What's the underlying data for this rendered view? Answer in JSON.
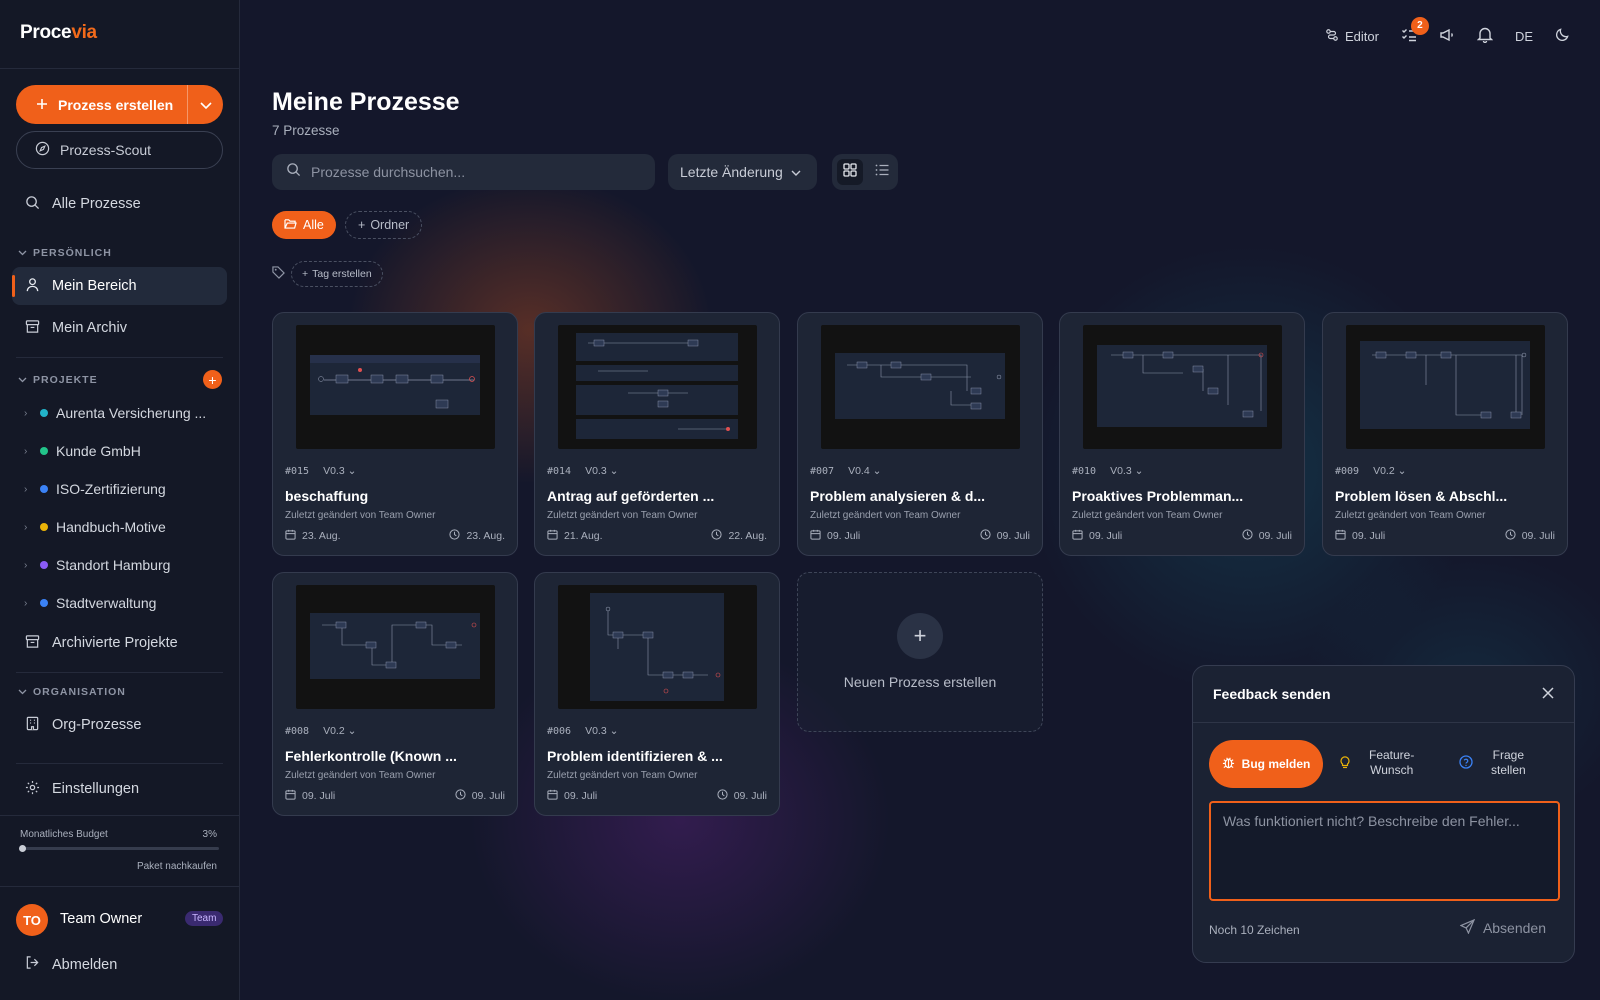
{
  "app": {
    "logo_main": "Proce",
    "logo_accent": "via"
  },
  "sidebar": {
    "create_label": "Prozess erstellen",
    "scout_label": "Prozess-Scout",
    "all_processes": "Alle Prozesse",
    "section_personal": "PERSÖNLICH",
    "my_area": "Mein Bereich",
    "my_archive": "Mein Archiv",
    "section_projects": "PROJEKTE",
    "projects": [
      {
        "name": "Aurenta Versicherung ...",
        "color": "#22b3c9"
      },
      {
        "name": "Kunde GmbH",
        "color": "#22c48a"
      },
      {
        "name": "ISO-Zertifizierung",
        "color": "#3b82f6"
      },
      {
        "name": "Handbuch-Motive",
        "color": "#eab308"
      },
      {
        "name": "Standort Hamburg",
        "color": "#8b5cf6"
      },
      {
        "name": "Stadtverwaltung",
        "color": "#3b82f6"
      }
    ],
    "archived_projects": "Archivierte Projekte",
    "section_org": "ORGANISATION",
    "org_processes": "Org-Prozesse",
    "settings": "Einstellungen",
    "budget_label": "Monatliches Budget",
    "budget_pct": "3%",
    "budget_fraction": 0.03,
    "budget_buy": "Paket nachkaufen",
    "user_initials": "TO",
    "user_name": "Team Owner",
    "user_badge": "Team",
    "logout": "Abmelden"
  },
  "topbar": {
    "editor_label": "Editor",
    "tasks_count": "2",
    "language": "DE"
  },
  "main": {
    "title": "Meine Prozesse",
    "subtitle": "7 Prozesse",
    "search_placeholder": "Prozesse durchsuchen...",
    "sort_label": "Letzte Änderung",
    "chip_all": "Alle",
    "chip_folder": "Ordner",
    "chip_tag": "Tag erstellen",
    "new_process": "Neuen Prozess erstellen"
  },
  "cards": [
    {
      "id": "#015",
      "version": "V0.3",
      "title": "beschaffung",
      "author": "Zuletzt geändert von Team Owner",
      "created": "23. Aug.",
      "modified": "23. Aug."
    },
    {
      "id": "#014",
      "version": "V0.3",
      "title": "Antrag auf geförderten ...",
      "author": "Zuletzt geändert von Team Owner",
      "created": "21. Aug.",
      "modified": "22. Aug."
    },
    {
      "id": "#007",
      "version": "V0.4",
      "title": "Problem analysieren & d...",
      "author": "Zuletzt geändert von Team Owner",
      "created": "09. Juli",
      "modified": "09. Juli"
    },
    {
      "id": "#010",
      "version": "V0.3",
      "title": "Proaktives Problemman...",
      "author": "Zuletzt geändert von Team Owner",
      "created": "09. Juli",
      "modified": "09. Juli"
    },
    {
      "id": "#009",
      "version": "V0.2",
      "title": "Problem lösen & Abschl...",
      "author": "Zuletzt geändert von Team Owner",
      "created": "09. Juli",
      "modified": "09. Juli"
    },
    {
      "id": "#008",
      "version": "V0.2",
      "title": "Fehlerkontrolle (Known ...",
      "author": "Zuletzt geändert von Team Owner",
      "created": "09. Juli",
      "modified": "09. Juli"
    },
    {
      "id": "#006",
      "version": "V0.3",
      "title": "Problem identifizieren & ...",
      "author": "Zuletzt geändert von Team Owner",
      "created": "09. Juli",
      "modified": "09. Juli"
    }
  ],
  "feedback": {
    "title": "Feedback senden",
    "tab_bug": "Bug melden",
    "tab_feature_1": "Feature-",
    "tab_feature_2": "Wunsch",
    "tab_question_1": "Frage",
    "tab_question_2": "stellen",
    "placeholder": "Was funktioniert nicht? Beschreibe den Fehler...",
    "remaining": "Noch 10 Zeichen",
    "send": "Absenden"
  },
  "colors": {
    "accent": "#f0601a",
    "bg": "#14172b"
  }
}
